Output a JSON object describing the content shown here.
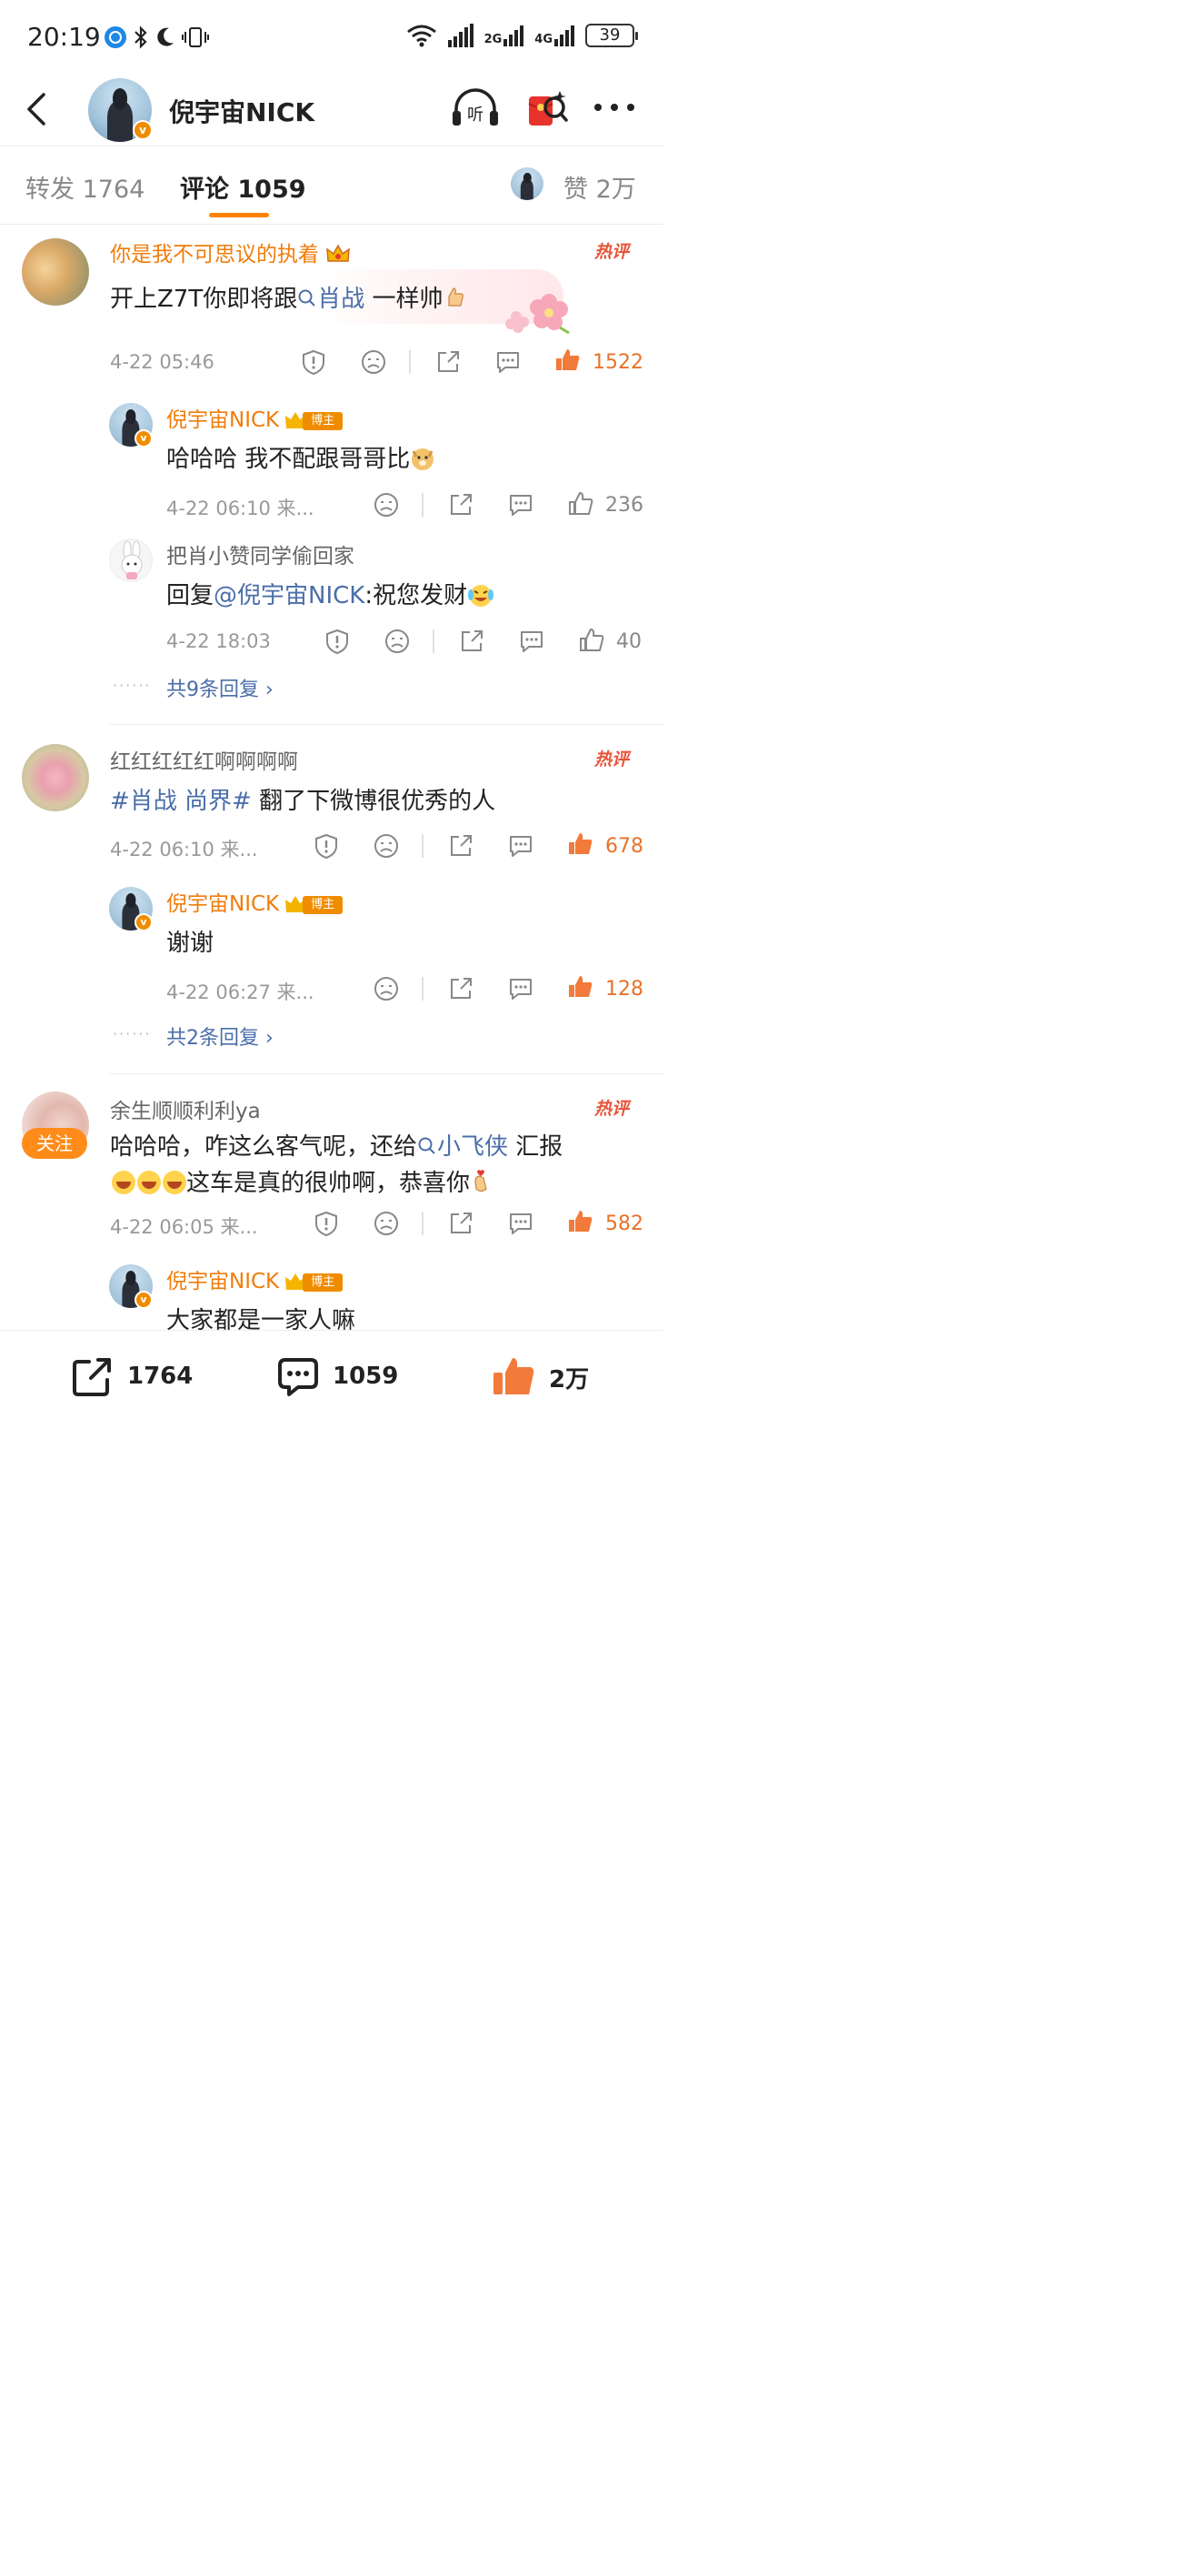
{
  "status_bar": {
    "time": "20:19",
    "network_2g": "2G",
    "network_4g": "4G",
    "battery": "39"
  },
  "header": {
    "title": "倪宇宙NICK"
  },
  "tabs": {
    "repost": "转发 1764",
    "comment": "评论 1059",
    "like": "赞 2万"
  },
  "comments": [
    {
      "user": "你是我不可思议的执着",
      "text_before": "开上Z7T你即将跟",
      "link": "肖战",
      "text_after": " 一样帅",
      "hot": "热评",
      "time": "4-22 05:46",
      "likes": "1522",
      "replies": [
        {
          "user": "倪宇宙NICK",
          "badge": "博主",
          "text": "哈哈哈 我不配跟哥哥比",
          "time": "4-22 06:10 来...",
          "likes": "236"
        },
        {
          "user": "把肖小赞同学偷回家",
          "reply_prefix": "回复",
          "reply_to": "@倪宇宙NICK",
          "text": ":祝您发财",
          "time": "4-22 18:03",
          "likes": "40"
        }
      ],
      "more_replies": "共9条回复 ›"
    },
    {
      "user": "红红红红红啊啊啊啊",
      "topic": "#肖战 尚界#",
      "text": " 翻了下微博很优秀的人",
      "hot": "热评",
      "time": "4-22 06:10 来...",
      "likes": "678",
      "replies": [
        {
          "user": "倪宇宙NICK",
          "badge": "博主",
          "text": "谢谢",
          "time": "4-22 06:27 来...",
          "likes": "128"
        }
      ],
      "more_replies": "共2条回复 ›"
    },
    {
      "user": "余生顺顺利利ya",
      "follow": "关注",
      "line1_before": "哈哈哈，咋这么客气呢，还给",
      "link": "小飞侠",
      "line1_after": " 汇报",
      "line2": "这车是真的很帅啊，恭喜你",
      "hot": "热评",
      "time": "4-22 06:05 来...",
      "likes": "582",
      "replies": [
        {
          "user": "倪宇宙NICK",
          "badge": "博主",
          "text": "大家都是一家人嘛"
        }
      ]
    }
  ],
  "bottom_bar": {
    "repost": "1764",
    "comment": "1059",
    "like": "2万"
  },
  "colors": {
    "accent": "#ff8200",
    "username_orange": "#f07c0a",
    "link": "#4a6ea9",
    "hot": "#e8553a"
  }
}
